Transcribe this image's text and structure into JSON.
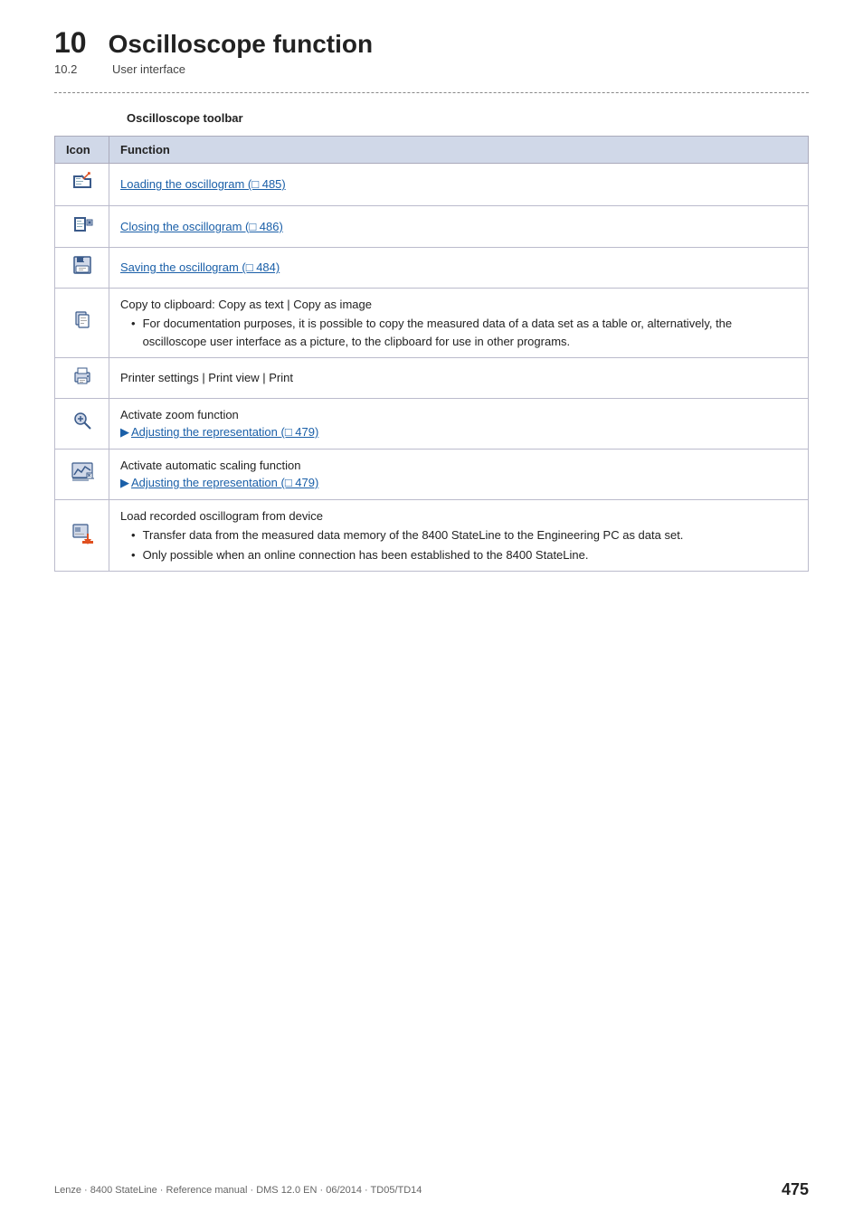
{
  "header": {
    "chapter_number": "10",
    "chapter_title": "Oscilloscope function",
    "subchapter_number": "10.2",
    "subchapter_title": "User interface"
  },
  "section": {
    "heading": "Oscilloscope toolbar"
  },
  "table": {
    "col_icon": "Icon",
    "col_function": "Function",
    "rows": [
      {
        "icon": "📂",
        "icon_name": "open-oscillogram-icon",
        "function_text": "",
        "link_text": "Loading the oscillogram",
        "link_ref": "485",
        "extra": ""
      },
      {
        "icon": "📁",
        "icon_name": "close-oscillogram-icon",
        "function_text": "",
        "link_text": "Closing the oscillogram",
        "link_ref": "486",
        "extra": ""
      },
      {
        "icon": "💾",
        "icon_name": "save-oscillogram-icon",
        "function_text": "",
        "link_text": "Saving the oscillogram",
        "link_ref": "484",
        "extra": ""
      },
      {
        "icon": "📋",
        "icon_name": "copy-clipboard-icon",
        "function_main": "Copy to clipboard: Copy as text | Copy as image",
        "function_bullets": [
          "For documentation purposes, it is possible to copy the measured data of a data set as a table or, alternatively, the oscilloscope user interface as a picture, to the clipboard for use in other programs."
        ],
        "type": "clipboard"
      },
      {
        "icon": "🖨",
        "icon_name": "printer-icon",
        "function_text": "Printer settings | Print view | Print",
        "type": "simple"
      },
      {
        "icon": "🔍",
        "icon_name": "zoom-icon",
        "function_main": "Activate zoom function",
        "link_text": "Adjusting the representation",
        "link_ref": "479",
        "type": "zoom"
      },
      {
        "icon": "⚖",
        "icon_name": "autoscale-icon",
        "function_main": "Activate automatic scaling function",
        "link_text": "Adjusting the representation",
        "link_ref": "479",
        "type": "autoscale"
      },
      {
        "icon": "⬇",
        "icon_name": "load-device-icon",
        "function_main": "Load recorded oscillogram from device",
        "function_bullets": [
          "Transfer data from the measured data memory of the 8400 StateLine to the Engineering PC as data set.",
          "Only possible when an online connection has been established to the 8400 StateLine."
        ],
        "type": "load"
      }
    ]
  },
  "footer": {
    "left_text": "Lenze · 8400 StateLine · Reference manual · DMS 12.0 EN · 06/2014 · TD05/TD14",
    "page_number": "475"
  }
}
